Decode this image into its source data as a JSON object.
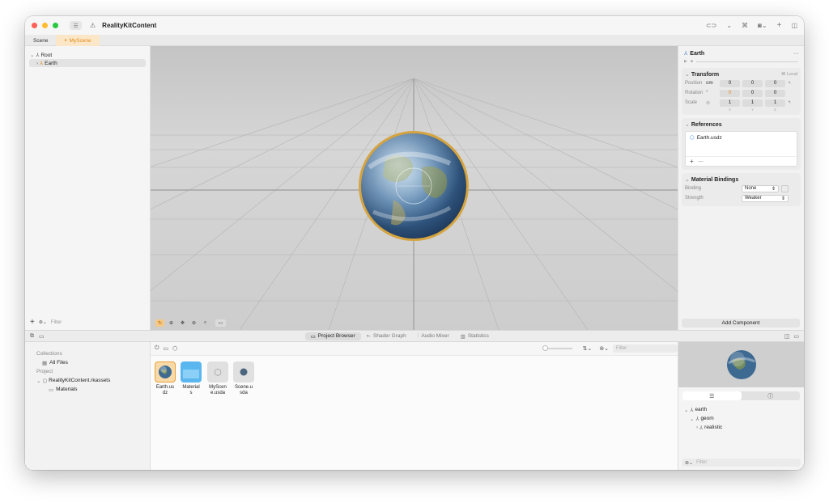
{
  "window": {
    "title": "RealityKitContent",
    "toolbar_icons": [
      "sidebar-icon",
      "warning-icon",
      "vr-headset-icon",
      "network-icon",
      "camera-icon",
      "plus-icon",
      "inspector-toggle-icon"
    ]
  },
  "colors": {
    "accent": "#e08a1a",
    "light_red": "#ff5f57",
    "light_yellow": "#febc2e",
    "light_green": "#28c840"
  },
  "tabs": [
    {
      "label": "Scene",
      "active": false
    },
    {
      "label": "MyScene",
      "active": true,
      "modified_dot": "●"
    }
  ],
  "hierarchy": {
    "root_label": "Root",
    "child_label": "Earth",
    "filter_placeholder": "Filter"
  },
  "inspector": {
    "title": "Earth",
    "more": "···",
    "transform": {
      "title": "Transform",
      "space": "Local",
      "position_label": "Position",
      "position_unit": "cm",
      "position": [
        "0",
        "0",
        "0"
      ],
      "rotation_label": "Rotation",
      "rotation_unit": "°",
      "rotation": [
        "0",
        "0",
        "0"
      ],
      "scale_label": "Scale",
      "scale": [
        "1",
        "1",
        "1"
      ],
      "axis_labels": [
        "X",
        "Y",
        "Z"
      ]
    },
    "references": {
      "title": "References",
      "item": "Earth.usdz",
      "add": "+",
      "remove": "—"
    },
    "material_bindings": {
      "title": "Material Bindings",
      "binding_label": "Binding",
      "binding_value": "None",
      "strength_label": "Strength",
      "strength_value": "Weaker"
    },
    "add_component": "Add Component"
  },
  "bottom_tabs": [
    {
      "label": "Project Browser",
      "icon": "folder-icon",
      "active": true
    },
    {
      "label": "Shader Graph",
      "icon": "shader-graph-icon",
      "active": false
    },
    {
      "label": "Audio Mixer",
      "icon": "audio-mixer-icon",
      "active": false
    },
    {
      "label": "Statistics",
      "icon": "statistics-icon",
      "active": false
    }
  ],
  "collections": {
    "collections_header": "Collections",
    "all_files": "All Files",
    "project_header": "Project",
    "package": "RealityKitContent.rkassets",
    "materials_folder": "Materials"
  },
  "browser": {
    "filter_placeholder": "Filter",
    "assets": [
      {
        "name": "Earth.usdz",
        "lines": [
          "Earth.us",
          "dz"
        ],
        "type": "earth",
        "selected": true
      },
      {
        "name": "Materials",
        "lines": [
          "Material",
          "s"
        ],
        "type": "folder",
        "selected": false
      },
      {
        "name": "MyScene.usda",
        "lines": [
          "MyScen",
          "e.usda"
        ],
        "type": "scene-empty",
        "selected": false
      },
      {
        "name": "Scene.usda",
        "lines": [
          "Scene.u",
          "sda"
        ],
        "type": "scene-sphere",
        "selected": false
      }
    ]
  },
  "preview": {
    "hierarchy": [
      "earth",
      "geom",
      "realistic"
    ],
    "filter_placeholder": "Filter"
  }
}
